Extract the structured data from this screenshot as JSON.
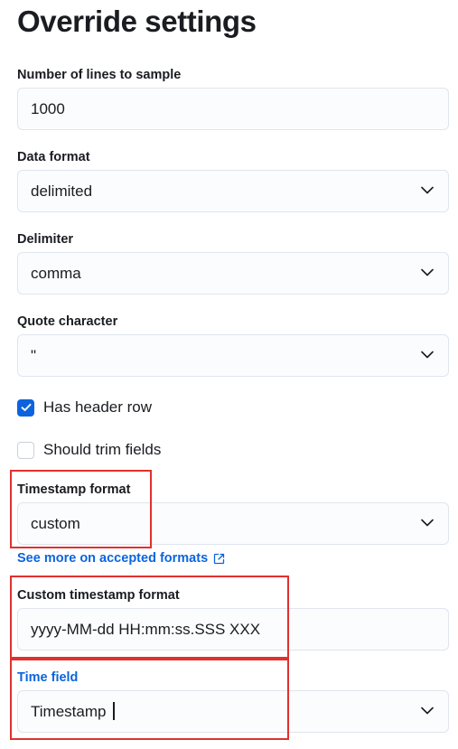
{
  "page": {
    "title": "Override settings"
  },
  "fields": {
    "lines_to_sample": {
      "label": "Number of lines to sample",
      "value": "1000"
    },
    "data_format": {
      "label": "Data format",
      "value": "delimited"
    },
    "delimiter": {
      "label": "Delimiter",
      "value": "comma"
    },
    "quote_character": {
      "label": "Quote character",
      "value": "\""
    },
    "timestamp_format": {
      "label": "Timestamp format",
      "value": "custom"
    },
    "custom_timestamp_format": {
      "label": "Custom timestamp format",
      "value": "yyyy-MM-dd HH:mm:ss.SSS XXX"
    },
    "time_field": {
      "label": "Time field",
      "value": "Timestamp"
    }
  },
  "checkboxes": {
    "has_header_row": {
      "label": "Has header row",
      "checked": true
    },
    "should_trim_fields": {
      "label": "Should trim fields",
      "checked": false
    }
  },
  "links": {
    "accepted_formats": "See more on accepted formats"
  },
  "icons": {
    "chevron": "chevron-down-icon",
    "check": "check-icon",
    "external": "external-link-icon"
  },
  "colors": {
    "accent": "#0b64dd",
    "highlight": "#e0312e",
    "field_border": "#dfe5ef"
  }
}
